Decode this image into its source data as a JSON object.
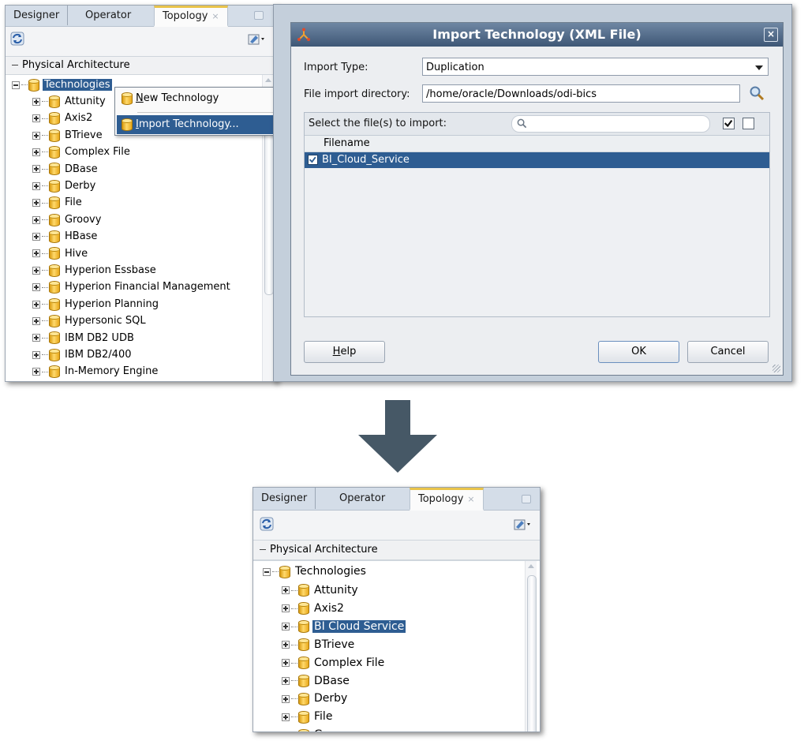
{
  "top_panel": {
    "tabs": [
      {
        "label": "Designer"
      },
      {
        "label": "Operator"
      },
      {
        "label": "Topology",
        "close": "×"
      }
    ],
    "section": "Physical Architecture",
    "tree_root": "Technologies",
    "tree_items": [
      "Attunity",
      "Axis2",
      "BTrieve",
      "Complex File",
      "DBase",
      "Derby",
      "File",
      "Groovy",
      "HBase",
      "Hive",
      "Hyperion Essbase",
      "Hyperion Financial Management",
      "Hyperion Planning",
      "Hypersonic SQL",
      "IBM DB2 UDB",
      "IBM DB2/400",
      "In-Memory Engine"
    ]
  },
  "context_menu": {
    "new_technology": {
      "mnemonic": "N",
      "rest": "ew Technology"
    },
    "import_technology": {
      "mnemonic": "I",
      "rest": "mport Technology..."
    }
  },
  "dialog": {
    "title": "Import Technology (XML File)",
    "close": "×",
    "import_type_label": "Import Type:",
    "import_type_value": "Duplication",
    "directory_label": "File import directory:",
    "directory_value": "/home/oracle/Downloads/odi-bics",
    "select_label": "Select the file(s) to import:",
    "column_header": "Filename",
    "files": [
      {
        "name": "BI_Cloud_Service",
        "checked": true
      }
    ],
    "help_mnemonic": "H",
    "help_rest": "elp",
    "ok_label": "OK",
    "cancel_label": "Cancel"
  },
  "bottom_panel": {
    "tabs": [
      {
        "label": "Designer"
      },
      {
        "label": "Operator"
      },
      {
        "label": "Topology",
        "close": "×"
      }
    ],
    "section": "Physical Architecture",
    "tree_root": "Technologies",
    "tree_items": [
      "Attunity",
      "Axis2",
      "BI Cloud Service",
      "BTrieve",
      "Complex File",
      "DBase",
      "Derby",
      "File",
      "Groovy"
    ],
    "selected_item": "BI Cloud Service"
  },
  "icons": {
    "refresh": "refresh-icon",
    "navigator_menu": "navigator-menu-icon",
    "search": "magnifier-icon",
    "technology": "database-icon",
    "flow": "down-arrow"
  },
  "colors": {
    "selection": "#2e5d92",
    "title_bar": "#4d6686",
    "active_tab_accent": "#e9c34a",
    "arrow": "#465866"
  }
}
